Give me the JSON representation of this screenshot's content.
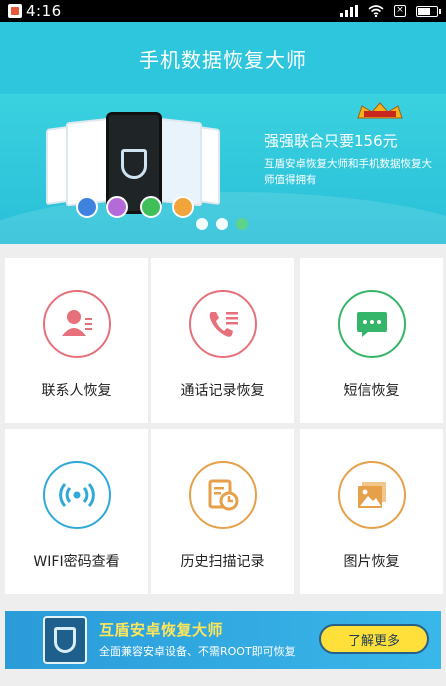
{
  "status_bar": {
    "time": "4:16",
    "icons": [
      "app-notification-icon",
      "signal-icon",
      "wifi-icon",
      "sim-icon",
      "battery-icon"
    ]
  },
  "header": {
    "title": "手机数据恢复大师"
  },
  "banner": {
    "promo_title": "强强联合只要156元",
    "promo_subtitle": "互盾安卓恢复大师和手机数据恢复大师值得拥有",
    "pages": 3,
    "active_page": 3
  },
  "features": [
    {
      "label": "联系人恢复",
      "icon": "contact-icon",
      "color": "#e8707a"
    },
    {
      "label": "通话记录恢复",
      "icon": "call-log-icon",
      "color": "#e8707a"
    },
    {
      "label": "短信恢复",
      "icon": "sms-icon",
      "color": "#35b56a"
    },
    {
      "label": "WIFI密码查看",
      "icon": "wifi-password-icon",
      "color": "#2fa9d8"
    },
    {
      "label": "历史扫描记录",
      "icon": "scan-history-icon",
      "color": "#e6a04a"
    },
    {
      "label": "图片恢复",
      "icon": "image-icon",
      "color": "#e6a04a"
    }
  ],
  "ad": {
    "title": "互盾安卓恢复大师",
    "subtitle": "全面兼容安卓设备、不需ROOT即可恢复",
    "button": "了解更多"
  },
  "colors": {
    "brand": "#2ec6dd",
    "ad_button": "#ffe03a"
  }
}
